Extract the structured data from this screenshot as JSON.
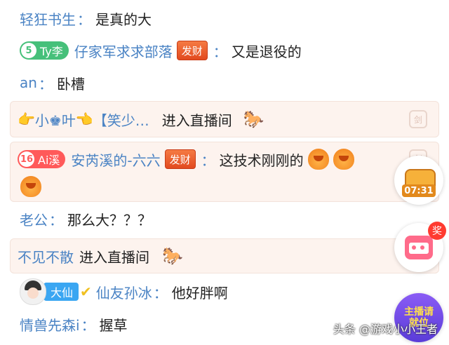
{
  "messages": {
    "m1": {
      "nick": "轻狂书生",
      "colon": "：",
      "text": "是真的大"
    },
    "m2": {
      "badge_level": "5",
      "badge_name": "Ty李",
      "nick": "仔家军求求部落",
      "tag": "发财",
      "colon": "：",
      "text": "又是退役的"
    },
    "m3": {
      "nick": "an",
      "colon": "：",
      "text": "卧槽"
    },
    "m4": {
      "left_emoji": "👉",
      "nick": "小♚叶",
      "right_emoji": "👈",
      "suffix": "【笑少…",
      "text": "进入直播间",
      "icon": "🐎"
    },
    "m5": {
      "badge_level": "16",
      "badge_name": "Ai溪",
      "nick": "安芮溪的-六六",
      "tag": "发财",
      "colon": "：",
      "text": "这技术刚刚的"
    },
    "m6": {
      "nick": "老公",
      "colon": "：",
      "text": "那么大？？？"
    },
    "m7": {
      "nick": "不见不散",
      "text": "进入直播间",
      "icon": "🐎"
    },
    "m8": {
      "badge_name": "大仙",
      "nick": "仙友孙冰",
      "colon": "：",
      "text": "他好胖啊"
    },
    "m9": {
      "nick": "情兽先森i",
      "colon": "：",
      "text": "握草"
    }
  },
  "sword_label": "剑",
  "widgets": {
    "chest_timer": "07:31",
    "reward_label": "奖",
    "anchor_label": "主播请就位"
  },
  "watermark": "头条 @游戏小小王者",
  "colors": {
    "nick": "#4a83c4",
    "card_bg": "#fdf3ee",
    "badge_green": "#46c07a",
    "badge_red": "#ff5a5a",
    "tag_orange": "#e8582a"
  }
}
